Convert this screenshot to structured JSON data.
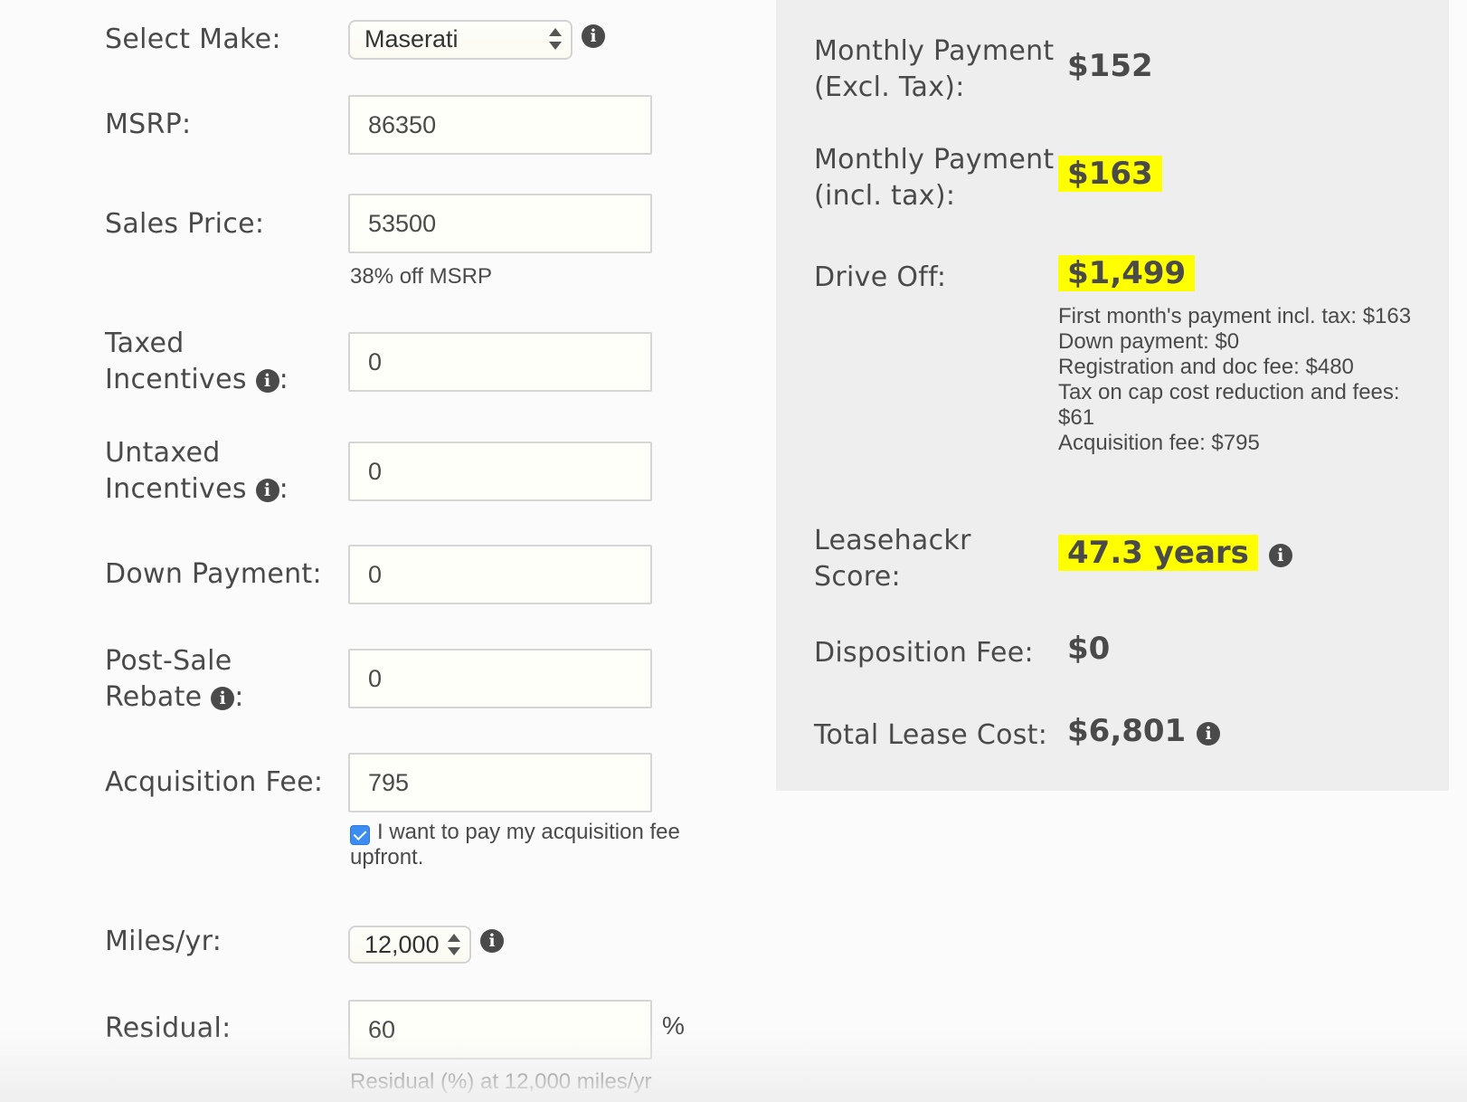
{
  "form": {
    "make": {
      "label": "Select Make:",
      "value": "Maserati"
    },
    "msrp": {
      "label": "MSRP:",
      "value": "86350"
    },
    "sales_price": {
      "label": "Sales Price:",
      "value": "53500",
      "hint": "38% off MSRP"
    },
    "taxed_incentives": {
      "label_line1": "Taxed",
      "label_line2": "Incentives",
      "value": "0"
    },
    "untaxed_incentives": {
      "label_line1": "Untaxed",
      "label_line2": "Incentives",
      "value": "0"
    },
    "down_payment": {
      "label": "Down Payment:",
      "value": "0"
    },
    "post_sale_rebate": {
      "label_line1": "Post-Sale",
      "label_line2": "Rebate",
      "value": "0"
    },
    "acquisition_fee": {
      "label": "Acquisition Fee:",
      "value": "795",
      "checkbox_label": "I want to pay my acquisition fee upfront.",
      "checked": true
    },
    "miles": {
      "label": "Miles/yr:",
      "value": "12,000"
    },
    "residual": {
      "label": "Residual:",
      "value": "60",
      "unit": "%",
      "hint": "Residual (%) at 12,000 miles/yr"
    }
  },
  "results": {
    "monthly_excl": {
      "label_line1": "Monthly Payment",
      "label_line2": "(Excl. Tax):",
      "value": "$152"
    },
    "monthly_incl": {
      "label_line1": "Monthly Payment",
      "label_line2": "(incl. tax):",
      "value": "$163"
    },
    "drive_off": {
      "label": "Drive Off:",
      "value": "$1,499",
      "breakdown": [
        "First month's payment incl. tax: $163",
        "Down payment: $0",
        "Registration and doc fee: $480",
        "Tax on cap cost reduction and fees: $61",
        "Acquisition fee: $795"
      ]
    },
    "score": {
      "label_line1": "Leasehackr",
      "label_line2": "Score:",
      "value": "47.3 years"
    },
    "disposition_fee": {
      "label": "Disposition Fee:",
      "value": "$0"
    },
    "total_lease_cost": {
      "label": "Total Lease Cost:",
      "value": "$6,801"
    }
  },
  "icons": {
    "info": "info-icon",
    "info_glyph": "i"
  },
  "colors": {
    "highlight": "#ffff00",
    "panel": "#eeeeee",
    "text": "#4a4a4a",
    "checkbox": "#3b8df1"
  }
}
